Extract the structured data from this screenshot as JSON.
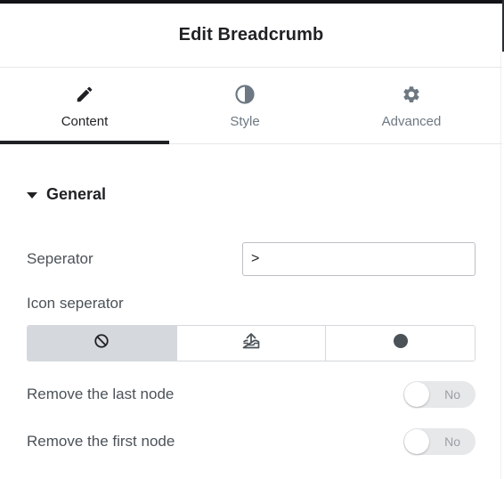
{
  "header": {
    "title": "Edit Breadcrumb"
  },
  "tabs": [
    {
      "label": "Content",
      "icon": "pencil-icon",
      "active": true
    },
    {
      "label": "Style",
      "icon": "half-circle-icon",
      "active": false
    },
    {
      "label": "Advanced",
      "icon": "gear-icon",
      "active": false
    }
  ],
  "section": {
    "title": "General",
    "expanded": true
  },
  "fields": {
    "separator": {
      "label": "Seperator",
      "value": ">"
    },
    "icon_separator": {
      "label": "Icon seperator",
      "options": [
        {
          "icon": "ban-icon",
          "selected": true
        },
        {
          "icon": "upload-tray-icon",
          "selected": false
        },
        {
          "icon": "dot-icon",
          "selected": false
        }
      ]
    },
    "remove_last": {
      "label": "Remove the last node",
      "toggle_text": "No",
      "on": false
    },
    "remove_first": {
      "label": "Remove the first node",
      "toggle_text": "No",
      "on": false
    }
  },
  "colors": {
    "text": "#1f2124",
    "muted": "#6d7882",
    "selected_bg": "#d5d8dc",
    "toggle_bg": "#e6e8ea"
  }
}
